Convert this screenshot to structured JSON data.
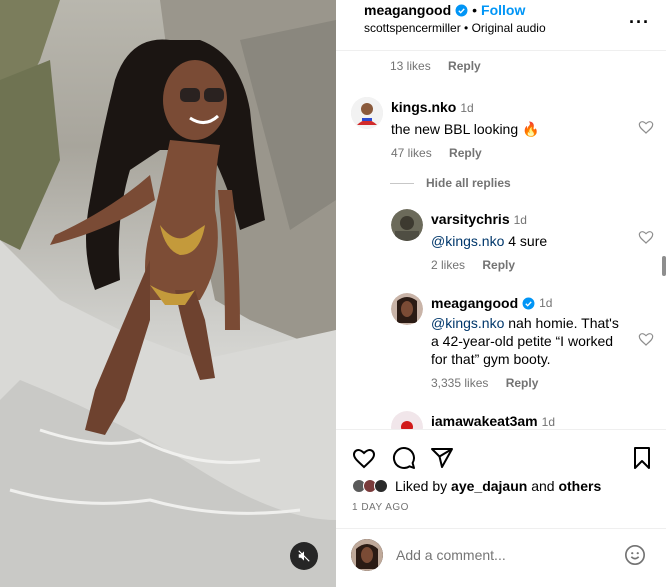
{
  "post": {
    "author": "meagangood",
    "follow_label": "Follow",
    "separator": "•",
    "audio_line": "scottspencermiller • Original audio",
    "more_icon": "more-horizontal-icon"
  },
  "prev_comment_meta": {
    "likes": "13 likes",
    "reply": "Reply"
  },
  "comments": [
    {
      "username": "kings.nko",
      "time": "1d",
      "text": "the new BBL looking 🔥",
      "likes": "47 likes",
      "reply": "Reply"
    }
  ],
  "hide_replies_label": "Hide all replies",
  "replies": [
    {
      "username": "varsitychris",
      "time": "1d",
      "mention": "@kings.nko",
      "text": " 4 sure",
      "likes": "2 likes",
      "reply": "Reply"
    },
    {
      "username": "meagangood",
      "time": "1d",
      "mention": "@kings.nko",
      "text_line1": " nah homie. That's",
      "text_line2": "a 42-year-old petite “I worked",
      "text_line3": "for that” gym booty.",
      "likes": "3,335 likes",
      "reply": "Reply"
    },
    {
      "username": "iamawakeat3am",
      "time": "1d"
    }
  ],
  "liked_by": {
    "prefix": "Liked by ",
    "user": "aye_dajaun",
    "middle": " and ",
    "others": "others"
  },
  "date": "1 DAY AGO",
  "comment_input": {
    "placeholder": "Add a comment..."
  },
  "colors": {
    "accent": "#0095f6",
    "verified": "#0095f6",
    "fire": "#ff6a00"
  }
}
